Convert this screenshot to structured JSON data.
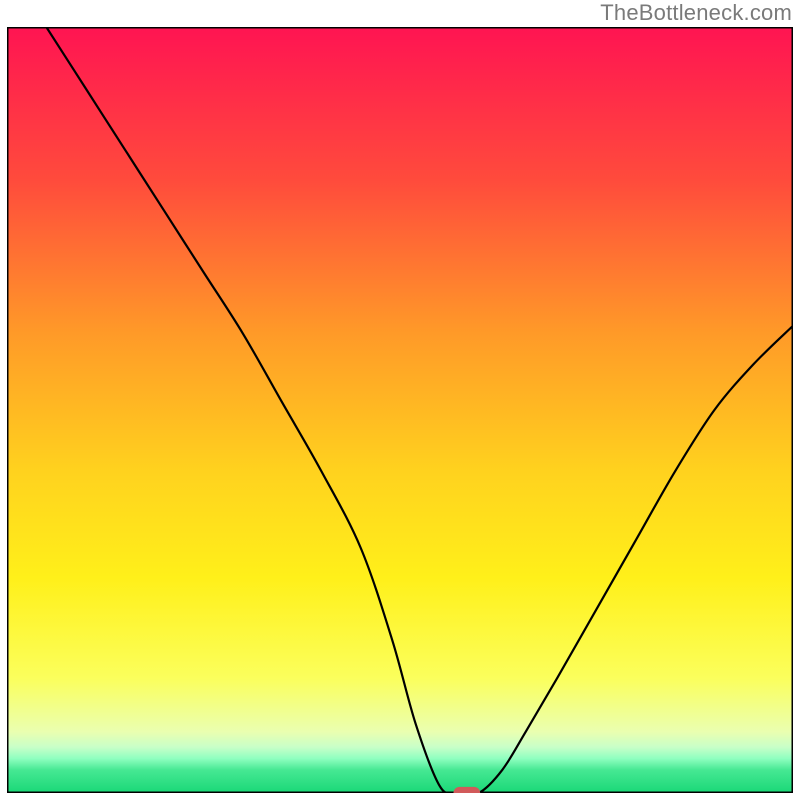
{
  "watermark": "TheBottleneck.com",
  "chart_data": {
    "type": "line",
    "title": "",
    "xlabel": "",
    "ylabel": "",
    "xlim": [
      0,
      100
    ],
    "ylim": [
      0,
      100
    ],
    "grid": false,
    "legend": false,
    "background_gradient": {
      "stops": [
        {
          "offset": 0.0,
          "color": "#ff1452"
        },
        {
          "offset": 0.2,
          "color": "#ff4b3c"
        },
        {
          "offset": 0.4,
          "color": "#ff9a28"
        },
        {
          "offset": 0.58,
          "color": "#ffd21e"
        },
        {
          "offset": 0.72,
          "color": "#fff01a"
        },
        {
          "offset": 0.85,
          "color": "#fbff5c"
        },
        {
          "offset": 0.92,
          "color": "#eaffb0"
        },
        {
          "offset": 0.94,
          "color": "#c8ffc8"
        },
        {
          "offset": 0.955,
          "color": "#8fffc0"
        },
        {
          "offset": 0.97,
          "color": "#46e893"
        },
        {
          "offset": 1.0,
          "color": "#19d877"
        }
      ]
    },
    "series": [
      {
        "name": "bottleneck-curve",
        "color": "#000000",
        "x": [
          5,
          10,
          15,
          20,
          25,
          30,
          35,
          40,
          45,
          49,
          52,
          55,
          57,
          60,
          63,
          66,
          70,
          75,
          80,
          85,
          90,
          95,
          100
        ],
        "y": [
          100,
          92,
          84,
          76,
          68,
          60,
          51,
          42,
          32,
          20,
          9,
          1,
          0,
          0,
          3,
          8,
          15,
          24,
          33,
          42,
          50,
          56,
          61
        ]
      }
    ],
    "marker": {
      "name": "optimal-point",
      "shape": "pill",
      "color": "#d15a5a",
      "x": 58.5,
      "y": 0,
      "width_x_units": 3.4,
      "height_y_units": 1.6
    }
  }
}
